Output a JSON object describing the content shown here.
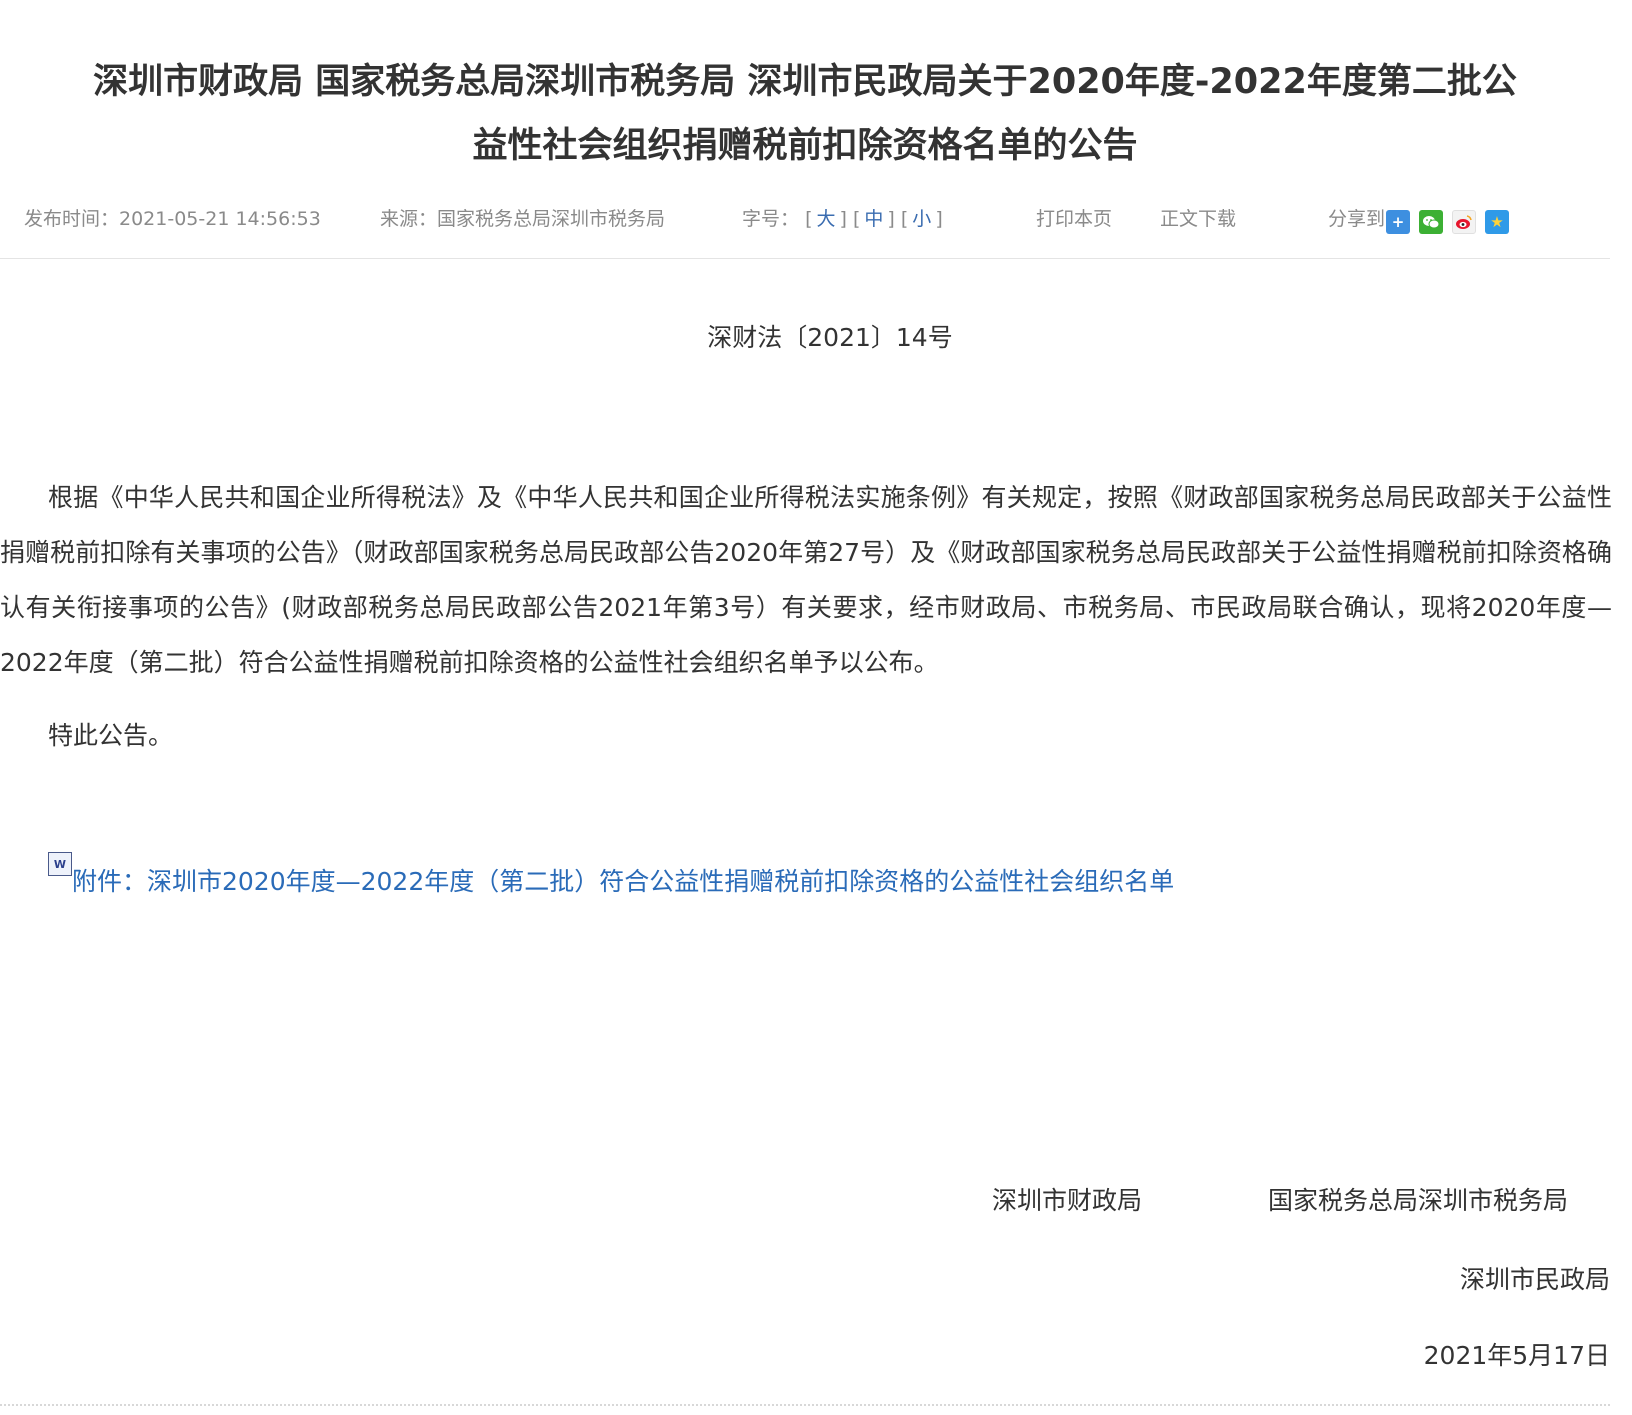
{
  "article": {
    "title_line1": "深圳市财政局 国家税务总局深圳市税务局 深圳市民政局关于2020年度-2022年度第二批公",
    "title_line2": "益性社会组织捐赠税前扣除资格名单的公告"
  },
  "meta": {
    "date": "发布时间：2021-05-21 14:56:53",
    "source": "来源：国家税务总局深圳市税务局",
    "font_size_label": "字号：",
    "size_large": "大",
    "size_medium": "中",
    "size_small": "小",
    "print": "打印本页",
    "download": "正文下载",
    "share_label": "分享到：",
    "share_icons": [
      "plus-icon",
      "wechat-icon",
      "weibo-icon",
      "qzone-icon"
    ]
  },
  "document": {
    "number": "深财法〔2021〕14号",
    "body": "根据《中华人民共和国企业所得税法》及《中华人民共和国企业所得税法实施条例》有关规定，按照《财政部国家税务总局民政部关于公益性捐赠税前扣除有关事项的公告》（财政部国家税务总局民政部公告2020年第27号）及《财政部国家税务总局民政部关于公益性捐赠税前扣除资格确认有关衔接事项的公告》(财政部税务总局民政部公告2021年第3号）有关要求，经市财政局、市税务局、市民政局联合确认，现将2020年度—2022年度（第二批）符合公益性捐赠税前扣除资格的公益性社会组织名单予以公布。",
    "closing": "特此公告。",
    "attachment": "附件：深圳市2020年度—2022年度（第二批）符合公益性捐赠税前扣除资格的公益性社会组织名单",
    "signer_1": "深圳市财政局",
    "signer_2": "国家税务总局深圳市税务局",
    "signer_3": "深圳市民政局",
    "signed_date": "2021年5月17日"
  },
  "colors": {
    "link": "#2a6bb8",
    "meta_text": "#8a8a8a",
    "body_text": "#333333"
  }
}
